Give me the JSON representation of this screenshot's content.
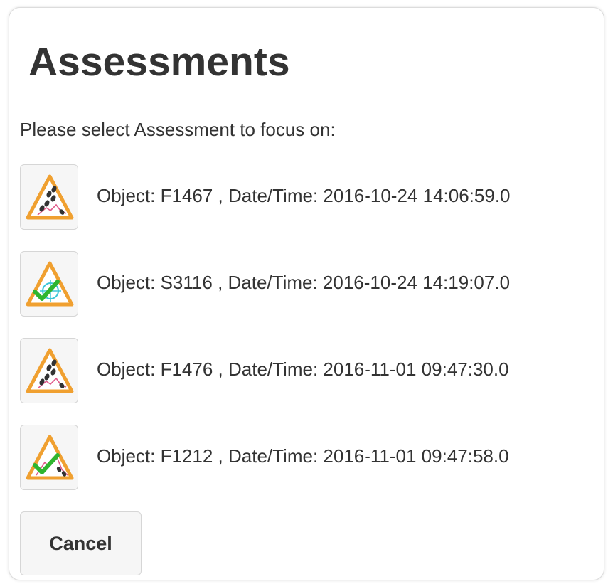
{
  "dialog": {
    "title": "Assessments",
    "prompt": "Please select Assessment to focus on:",
    "cancel_label": "Cancel"
  },
  "assessments": [
    {
      "text": "Object: F1467 , Date/Time: 2016-10-24 14:06:59.0",
      "icon": "footsteps-warning-icon"
    },
    {
      "text": "Object: S3116 , Date/Time: 2016-10-24 14:19:07.0",
      "icon": "target-check-warning-icon"
    },
    {
      "text": "Object: F1476 , Date/Time: 2016-11-01 09:47:30.0",
      "icon": "footsteps-warning-icon"
    },
    {
      "text": "Object: F1212 , Date/Time: 2016-11-01 09:47:58.0",
      "icon": "footsteps-check-warning-icon"
    }
  ],
  "colors": {
    "warning_orange": "#f0a030",
    "check_green": "#2fb52f",
    "accent_pink": "#e05a8a",
    "target_cyan": "#3cc6d8"
  }
}
